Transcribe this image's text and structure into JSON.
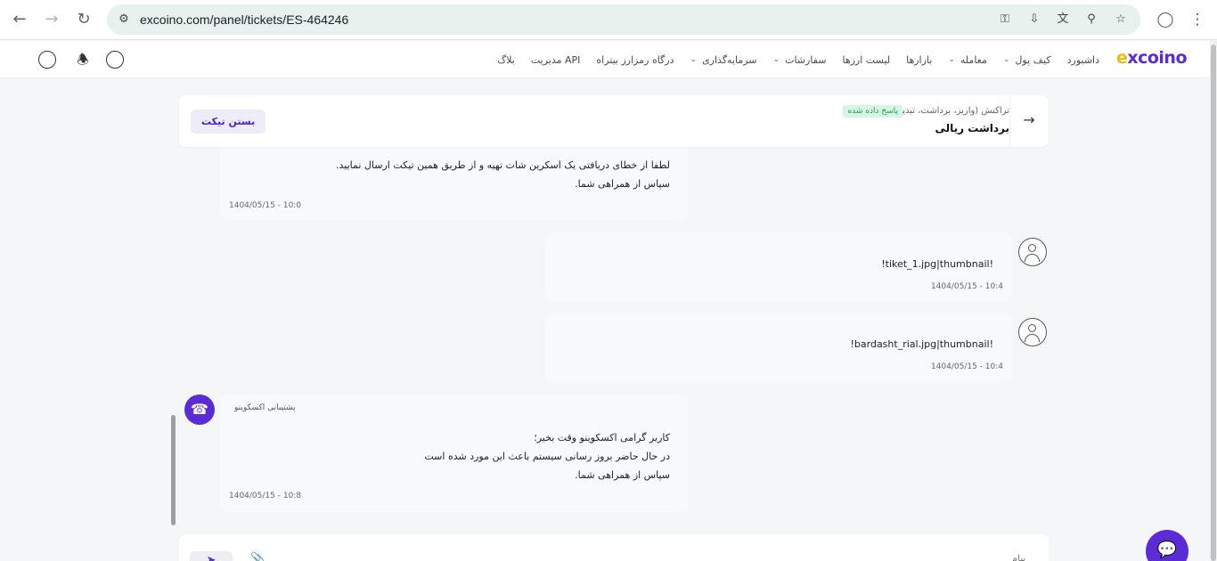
{
  "browser": {
    "url": "excoino.com/panel/tickets/ES-464246",
    "icons": [
      "back-arrow",
      "forward-arrow",
      "reload",
      "site-settings",
      "password-key",
      "install-app",
      "translate",
      "zoom",
      "bookmark-star",
      "profile",
      "more-vert"
    ]
  },
  "header": {
    "logo_e": "e",
    "logo_rest": "xcoino",
    "menu": [
      {
        "label": "داشبورد",
        "has_dropdown": false
      },
      {
        "label": "کیف پول",
        "has_dropdown": true
      },
      {
        "label": "معامله",
        "has_dropdown": true
      },
      {
        "label": "بازارها",
        "has_dropdown": false
      },
      {
        "label": "لیست ارزها",
        "has_dropdown": false
      },
      {
        "label": "سفارشات",
        "has_dropdown": true
      },
      {
        "label": "سرمایه‌گذاری",
        "has_dropdown": true
      },
      {
        "label": "درگاه رمزارز بیتراه",
        "has_dropdown": false
      },
      {
        "label": "مدیریت API",
        "has_dropdown": false
      },
      {
        "label": "بلاگ",
        "has_dropdown": false
      }
    ]
  },
  "ticket": {
    "category": "تراکنش (واریز، برداشت، تبدیل)",
    "status": "پاسخ داده شده",
    "title": "برداشت ریالی",
    "close_label": "بستن تیکت"
  },
  "messages": {
    "m1": {
      "line1": "لطفا از خطای دریافتی یک اسکرین شات تهیه و از طریق همین تیکت ارسال نمایید.",
      "line2": "سپاس از همراهی شما.",
      "time": "1404/05/15 - 10:0"
    },
    "m2": {
      "text": "!tiket_1.jpg|thumbnail!",
      "time": "1404/05/15 - 10:4"
    },
    "m3": {
      "text": "!bardasht_rial.jpg|thumbnail!",
      "time": "1404/05/15 - 10:4"
    },
    "m4": {
      "sender": "پشتیبانی اکسکوینو",
      "line1": "کاربر گرامی اکسکوینو وقت بخیر؛",
      "line2": "در حال حاضر بروز رسانی سیستم باعث این مورد شده است",
      "line3": "سپاس از همراهی شما.",
      "time": "1404/05/15 - 10:8"
    }
  },
  "composer": {
    "placeholder": "پیام"
  },
  "colors": {
    "brand": "#5b2bd6",
    "logo_accent": "#f0b90b",
    "status_bg": "#d8f5e3",
    "status_fg": "#1f9d57"
  }
}
